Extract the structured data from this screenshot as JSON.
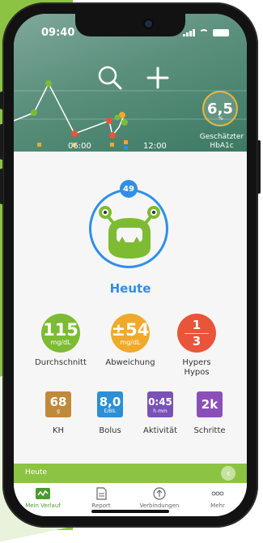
{
  "status": {
    "time": "09:40"
  },
  "header": {
    "x_ticks": [
      "06:00",
      "12:00"
    ],
    "hba1c_value": "6,5",
    "hba1c_unit": "%",
    "hba1c_label_1": "Geschätzter",
    "hba1c_label_2": "HbA1c"
  },
  "icons": {
    "search": "search-icon",
    "add": "plus-icon",
    "monster": "monster-icon"
  },
  "monster": {
    "badge": "49",
    "title": "Heute"
  },
  "stats": [
    {
      "value": "115",
      "unit": "mg/dL",
      "label": "Durchschnitt",
      "color": "#7dbb32"
    },
    {
      "value": "±54",
      "unit": "mg/dL",
      "label": "Abweichung",
      "color": "#f0a92a"
    },
    {
      "top": "1",
      "bottom": "3",
      "label_1": "Hypers",
      "label_2": "Hypos",
      "color": "#e8553a"
    }
  ],
  "tiles": [
    {
      "value": "68",
      "unit": "g",
      "label": "KH",
      "color": "#c08a3a"
    },
    {
      "value": "8,0",
      "unit": "E/BIL",
      "label": "Bolus",
      "color": "#2d8fd6"
    },
    {
      "value": "0:45",
      "unit": "h mm",
      "label": "Aktivität",
      "color": "#7a52b5"
    },
    {
      "value": "2k",
      "unit": "",
      "label": "Schritte",
      "color": "#8b50b8"
    }
  ],
  "today_bar": {
    "label": "Heute"
  },
  "tabs": [
    {
      "label": "Mein Verlauf",
      "active": true
    },
    {
      "label": "Report",
      "active": false
    },
    {
      "label": "Verbindungen",
      "active": false
    },
    {
      "label": "Mehr",
      "active": false
    }
  ],
  "colors": {
    "brand_green": "#8cc342",
    "accent_blue": "#2f8fe8",
    "hba1c_ring": "#f0b43c"
  }
}
